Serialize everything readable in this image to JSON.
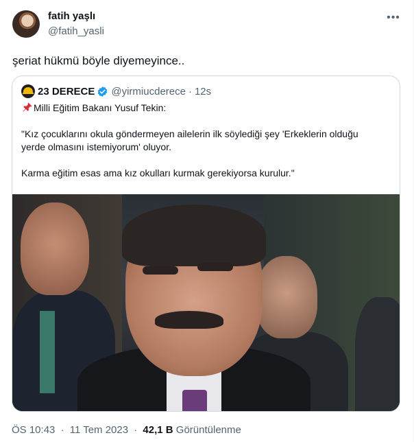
{
  "tweet": {
    "author_name": "fatih yaşlı",
    "author_handle": "@fatih_yasli",
    "more_icon": "ellipsis-icon",
    "text": "şeriat hükmü böyle diyemeyince..",
    "time": "ÖS 10:43",
    "date": "11 Tem 2023",
    "separator": "·",
    "views_count": "42,1 B",
    "views_label": "Görüntülenme"
  },
  "quote": {
    "author_name": "23 DERECE",
    "verified_icon": "verified-badge-icon",
    "author_handle": "@yirmiucderece",
    "separator": "·",
    "time": "12s",
    "pin_icon": "pushpin-icon",
    "lines": [
      "Milli Eğitim Bakanı Yusuf Tekin:",
      "",
      "\"Kız çocuklarını okula göndermeyen ailelerin ilk söylediği şey 'Erkeklerin olduğu",
      "yerde olmasını istemiyorum' oluyor.",
      "",
      "Karma eğitim esas ama kız okulları kurmak gerekiyorsa kurulur.\""
    ]
  },
  "colors": {
    "text_primary": "#0f1419",
    "text_secondary": "#536471",
    "border": "#cfd9de",
    "verified_blue": "#1d9bf0",
    "pin_red": "#d92b3a"
  }
}
